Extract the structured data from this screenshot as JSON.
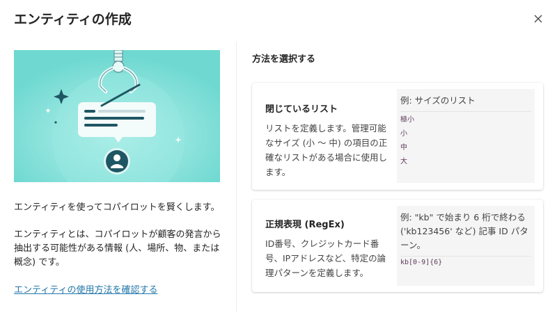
{
  "dialog": {
    "title": "エンティティの作成",
    "close_icon": "close-icon"
  },
  "left": {
    "illustration": "entity-claw-illustration",
    "lead": "エンティティを使ってコパイロットを賢くします。",
    "description": "エンティティとは、コパイロットが顧客の発言から抽出する可能性がある情報 (人、場所、物、または概念) です。",
    "link": "エンティティの使用方法を確認する"
  },
  "right": {
    "heading": "方法を選択する",
    "options": [
      {
        "title": "閉じているリスト",
        "description": "リストを定義します。管理可能なサイズ (小 ～ 中) の項目の正確なリストがある場合に使用します。",
        "example_label": "例: サイズのリスト",
        "example_items": [
          "極小",
          "小",
          "中",
          "大"
        ]
      },
      {
        "title": "正規表現 (RegEx)",
        "description": "ID番号、クレジットカード番号、IPアドレスなど、特定の論理パターンを定義します。",
        "example_label": "例: \"kb\" で始まり 6 桁で終わる ('kb123456' など) 記事 ID パターン。",
        "example_code": "kb[0-9]{6}"
      }
    ]
  },
  "colors": {
    "illustration_bg": "#7adfd8",
    "link": "#2176a8",
    "example_bg": "#f5f5f5",
    "code_text": "#5c3a58"
  }
}
